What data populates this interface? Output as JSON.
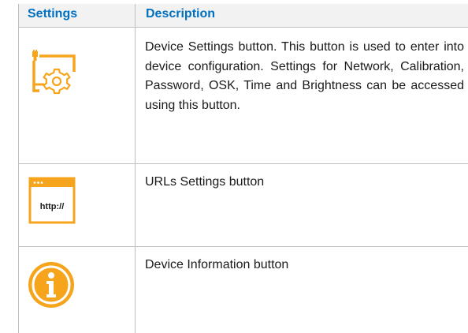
{
  "table": {
    "headers": {
      "settings": "Settings",
      "description": "Description"
    },
    "rows": [
      {
        "icon": "device-settings-icon",
        "description": "Device Settings button. This button is used to enter into device configuration. Settings for Network, Calibration, Password, OSK, Time and Brightness can be accessed using this button."
      },
      {
        "icon": "url-settings-icon",
        "icon_label": "http://",
        "description": "URLs Settings button"
      },
      {
        "icon": "info-icon",
        "description": "Device Information button"
      }
    ]
  },
  "colors": {
    "accent_orange": "#f7a41d",
    "header_blue": "#0070c0",
    "header_bg": "#f2f2f2",
    "border": "#bfbfbf"
  }
}
